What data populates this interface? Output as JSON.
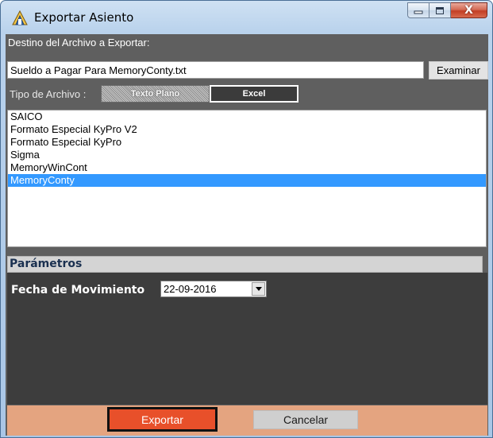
{
  "window": {
    "title": "Exportar Asiento",
    "icon": "export-app-icon",
    "controls": {
      "minimize": "minimize-icon",
      "maximize": "maximize-icon",
      "close_label": "X"
    }
  },
  "destination": {
    "label": "Destino del Archivo a Exportar:",
    "path_value": "Sueldo a Pagar Para MemoryConty.txt",
    "browse_label": "Examinar"
  },
  "file_type": {
    "label": "Tipo de Archivo :",
    "options": [
      "Texto Plano",
      "Excel"
    ],
    "selected": "Texto Plano"
  },
  "formats": {
    "items": [
      "SAICO",
      "Formato Especial KyPro V2",
      "Formato Especial KyPro",
      "Sigma",
      "MemoryWinCont",
      "MemoryConty"
    ],
    "selected": "MemoryConty"
  },
  "parameters": {
    "header": "Parámetros",
    "date_label": "Fecha de Movimiento",
    "date_value": "22-09-2016"
  },
  "footer": {
    "export_label": "Exportar",
    "cancel_label": "Cancelar"
  },
  "colors": {
    "client_bg": "#5f5f5f",
    "selection": "#3399ff",
    "footer_bg": "#e4a480",
    "export_bg": "#e8502a",
    "params_panel_bg": "#3d3d3d"
  }
}
